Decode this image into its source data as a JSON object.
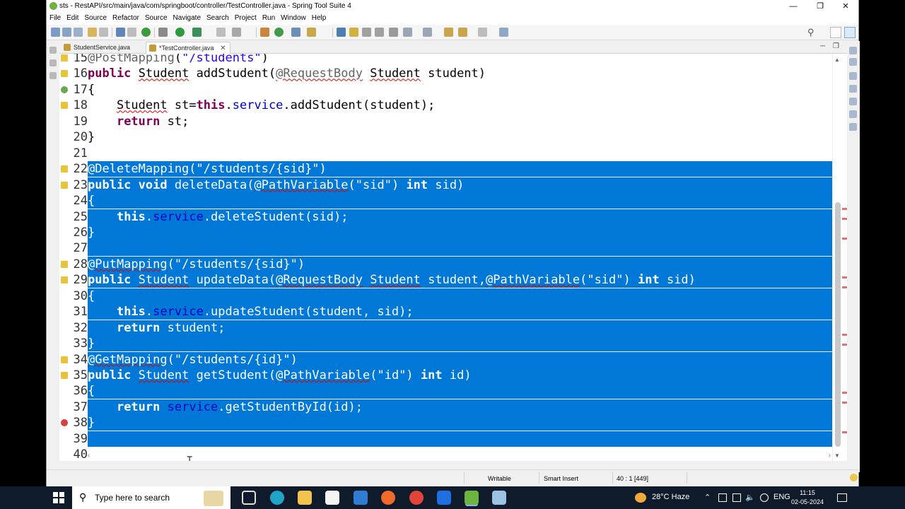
{
  "window": {
    "title": "sts - RestAPI/src/main/java/com/springboot/controller/TestController.java - Spring Tool Suite 4",
    "minimize": "—",
    "maximize": "❐",
    "close": "✕"
  },
  "menu": [
    "File",
    "Edit",
    "Source",
    "Refactor",
    "Source",
    "Navigate",
    "Search",
    "Project",
    "Run",
    "Window",
    "Help"
  ],
  "tabs": [
    {
      "label": "StudentService.java",
      "active": false
    },
    {
      "label": "*TestController.java",
      "active": true,
      "close": "✕"
    }
  ],
  "editor": {
    "selection_color": "#0078d7",
    "lines": [
      {
        "n": "15",
        "text": "@PostMapping(\"/students\")",
        "sel": false
      },
      {
        "n": "16",
        "text": "public Student addStudent(@RequestBody Student student)",
        "sel": false
      },
      {
        "n": "17",
        "text": "{",
        "sel": false
      },
      {
        "n": "18",
        "text": "    Student st=this.service.addStudent(student);",
        "sel": false
      },
      {
        "n": "19",
        "text": "    return st;",
        "sel": false
      },
      {
        "n": "20",
        "text": "}",
        "sel": false
      },
      {
        "n": "21",
        "text": "",
        "sel": false
      },
      {
        "n": "22",
        "text": "@DeleteMapping(\"/students/{sid}\")",
        "sel": true
      },
      {
        "n": "23",
        "text": "public void deleteData(@PathVariable(\"sid\") int sid)",
        "sel": true
      },
      {
        "n": "24",
        "text": "{",
        "sel": true
      },
      {
        "n": "25",
        "text": "    this.service.deleteStudent(sid);",
        "sel": true
      },
      {
        "n": "26",
        "text": "}",
        "sel": true
      },
      {
        "n": "27",
        "text": "",
        "sel": true
      },
      {
        "n": "28",
        "text": "@PutMapping(\"/students/{sid}\")",
        "sel": true
      },
      {
        "n": "29",
        "text": "public Student updateData(@RequestBody Student student,@PathVariable(\"sid\") int sid)",
        "sel": true
      },
      {
        "n": "30",
        "text": "{",
        "sel": true
      },
      {
        "n": "31",
        "text": "    this.service.updateStudent(student, sid);",
        "sel": true
      },
      {
        "n": "32",
        "text": "    return student;",
        "sel": true
      },
      {
        "n": "33",
        "text": "}",
        "sel": true
      },
      {
        "n": "34",
        "text": "@GetMapping(\"/students/{id}\")",
        "sel": true
      },
      {
        "n": "35",
        "text": "public Student getStudent(@PathVariable(\"id\") int id)",
        "sel": true
      },
      {
        "n": "36",
        "text": "{",
        "sel": true
      },
      {
        "n": "37",
        "text": "    return service.getStudentById(id);",
        "sel": true
      },
      {
        "n": "38",
        "text": "}",
        "sel": true
      },
      {
        "n": "39",
        "text": "",
        "sel": true
      },
      {
        "n": "40",
        "text": "",
        "sel": false
      }
    ]
  },
  "status": {
    "writable": "Writable",
    "insert_mode": "Smart Insert",
    "position": "40 : 1 [449]"
  },
  "taskbar": {
    "search_placeholder": "Type here to search",
    "weather": "28°C  Haze",
    "language": "ENG",
    "time": "11:15",
    "date": "02-05-2024"
  }
}
